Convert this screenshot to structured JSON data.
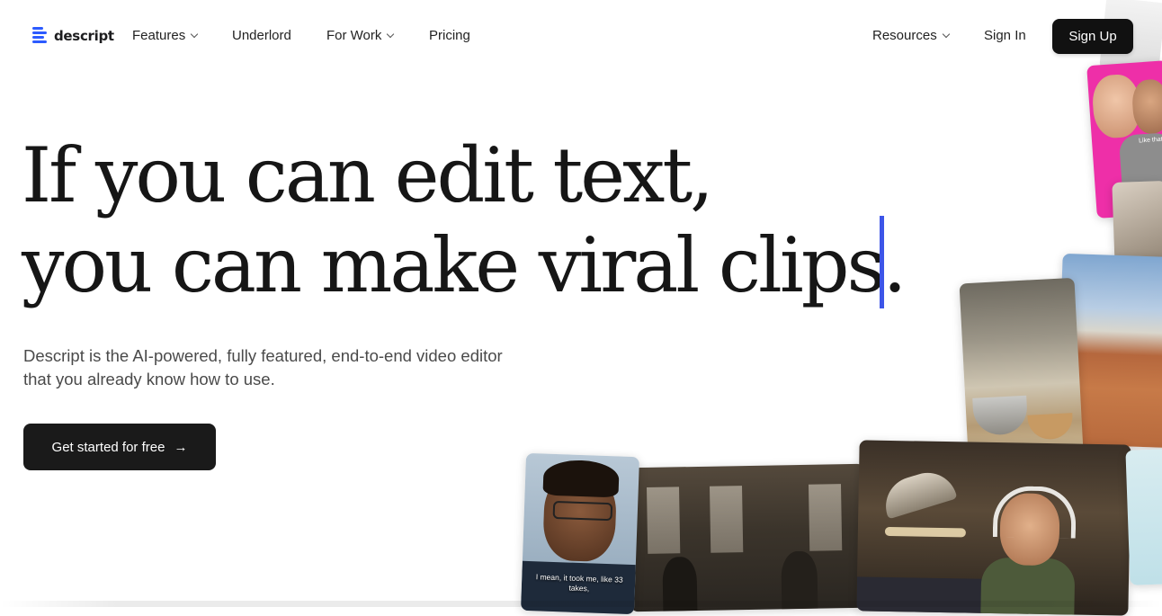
{
  "brand": {
    "name": "descript",
    "accent_color": "#2c5bff",
    "caret_color": "#3d55e8"
  },
  "nav": {
    "items": [
      {
        "label": "Features",
        "has_dropdown": true
      },
      {
        "label": "Underlord",
        "has_dropdown": false
      },
      {
        "label": "For Work",
        "has_dropdown": true
      },
      {
        "label": "Pricing",
        "has_dropdown": false
      }
    ],
    "resources_label": "Resources",
    "signin_label": "Sign In",
    "signup_label": "Sign Up"
  },
  "hero": {
    "headline_line1": "If you can edit text,",
    "headline_line2": "you can make viral clips.",
    "subtext_line1": "Descript is the AI-powered, fully featured, end-to-end video editor",
    "subtext_line2": "that you already know how to use.",
    "cta_label": "Get started for free",
    "cta_icon": "arrow-right-icon"
  },
  "collage": {
    "caption_man": "I mean, it took me, like 33 takes,",
    "caption_pink": "Like that"
  }
}
